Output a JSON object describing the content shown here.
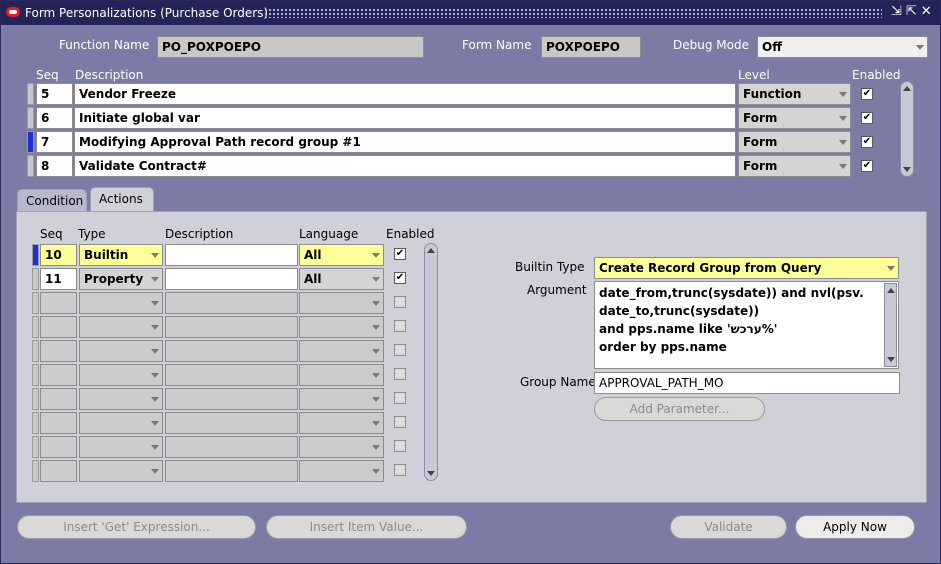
{
  "window": {
    "title": "Form Personalizations (Purchase Orders)",
    "controls": "⇲⇱✕"
  },
  "header": {
    "function_name_label": "Function Name",
    "function_name_value": "PO_POXPOEPO",
    "form_name_label": "Form Name",
    "form_name_value": "POXPOEPO",
    "debug_mode_label": "Debug Mode",
    "debug_mode_value": "Off"
  },
  "rules_grid": {
    "headers": {
      "seq": "Seq",
      "description": "Description",
      "level": "Level",
      "enabled": "Enabled"
    },
    "rows": [
      {
        "seq": "5",
        "description": "Vendor Freeze",
        "level": "Function",
        "enabled": "✔",
        "active": false
      },
      {
        "seq": "6",
        "description": "Initiate global var",
        "level": "Form",
        "enabled": "✔",
        "active": false
      },
      {
        "seq": "7",
        "description": "Modifying Approval Path record group #1",
        "level": "Form",
        "enabled": "✔",
        "active": true
      },
      {
        "seq": "8",
        "description": "Validate Contract#",
        "level": "Form",
        "enabled": "✔",
        "active": false
      }
    ]
  },
  "tabs": {
    "condition": "Condition",
    "actions": "Actions"
  },
  "actions_grid": {
    "headers": {
      "seq": "Seq",
      "type": "Type",
      "description": "Description",
      "language": "Language",
      "enabled": "Enabled"
    },
    "rows": [
      {
        "seq": "10",
        "type": "Builtin",
        "description": "",
        "language": "All",
        "enabled": "✔"
      },
      {
        "seq": "11",
        "type": "Property",
        "description": "",
        "language": "All",
        "enabled": "✔"
      }
    ]
  },
  "details": {
    "builtin_type_label": "Builtin Type",
    "builtin_type_value": "Create Record Group from Query",
    "argument_label": "Argument",
    "argument_lines": [
      "date_from,trunc(sysdate)) and nvl(psv.",
      "date_to,trunc(sysdate))",
      "and pps.name like 'ערכש%'",
      "order by pps.name"
    ],
    "group_name_label": "Group Name",
    "group_name_value": "APPROVAL_PATH_MO",
    "add_parameter_button": "Add Parameter..."
  },
  "bottom_buttons": {
    "insert_get_expression": "Insert 'Get' Expression...",
    "insert_item_value": "Insert Item Value...",
    "validate": "Validate",
    "apply_now": "Apply Now"
  }
}
